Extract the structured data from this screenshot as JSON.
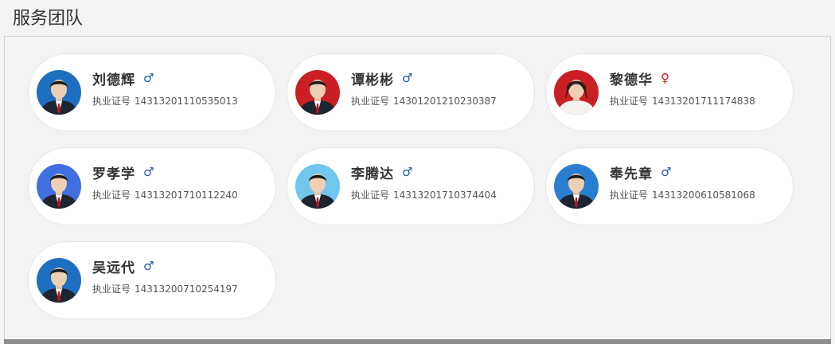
{
  "header": {
    "title": "服务团队"
  },
  "license_label": "执业证号",
  "members": [
    {
      "name": "刘德辉",
      "gender": "male",
      "gender_symbol": "♂",
      "license_no": "14313201110535013",
      "bg": "#1f6fc0"
    },
    {
      "name": "谭彬彬",
      "gender": "male",
      "gender_symbol": "♂",
      "license_no": "14301201210230387",
      "bg": "#c91f25"
    },
    {
      "name": "黎德华",
      "gender": "female",
      "gender_symbol": "♀",
      "license_no": "14313201711174838",
      "bg": "#c91f25"
    },
    {
      "name": "罗孝学",
      "gender": "male",
      "gender_symbol": "♂",
      "license_no": "14313201710112240",
      "bg": "#3f6fe0"
    },
    {
      "name": "李腾达",
      "gender": "male",
      "gender_symbol": "♂",
      "license_no": "14313201710374404",
      "bg": "#6fc6ee"
    },
    {
      "name": "奉先章",
      "gender": "male",
      "gender_symbol": "♂",
      "license_no": "14313200610581068",
      "bg": "#2a7ed0"
    },
    {
      "name": "吴远代",
      "gender": "male",
      "gender_symbol": "♂",
      "license_no": "14313200710254197",
      "bg": "#1f6fc0"
    }
  ]
}
